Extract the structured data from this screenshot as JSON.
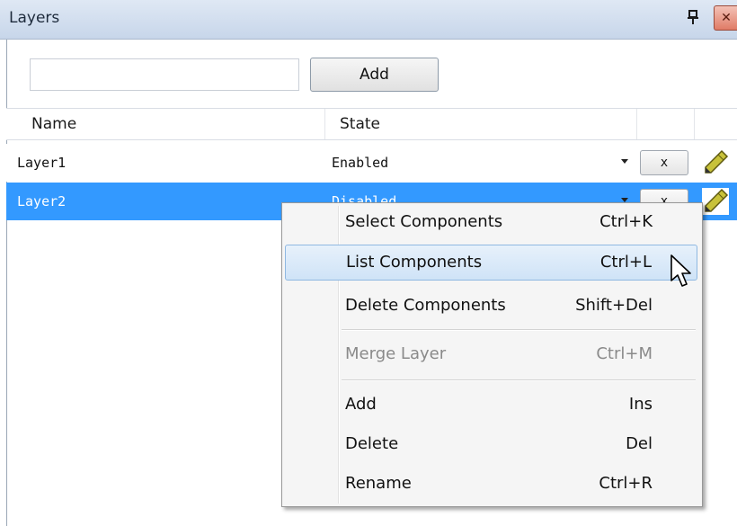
{
  "window": {
    "title": "Layers",
    "pin_icon": "pin-icon",
    "close_icon": "close-icon",
    "close_glyph": "✕"
  },
  "toolbar": {
    "search_value": "",
    "add_label": "Add"
  },
  "grid": {
    "columns": [
      "Name",
      "State",
      "",
      ""
    ],
    "rows": [
      {
        "name": "Layer1",
        "state": "Enabled",
        "delete_label": "x",
        "selected": false
      },
      {
        "name": "Layer2",
        "state": "Disabled",
        "delete_label": "x",
        "selected": true
      }
    ]
  },
  "context_menu": {
    "items": [
      {
        "label": "Select Components",
        "shortcut": "Ctrl+K",
        "enabled": true,
        "highlighted": false
      },
      {
        "label": "List Components",
        "shortcut": "Ctrl+L",
        "enabled": true,
        "highlighted": true
      },
      {
        "label": "Delete Components",
        "shortcut": "Shift+Del",
        "enabled": true,
        "highlighted": false
      },
      {
        "label": "Merge Layer",
        "shortcut": "Ctrl+M",
        "enabled": false,
        "highlighted": false
      },
      {
        "label": "Add",
        "shortcut": "Ins",
        "enabled": true,
        "highlighted": false
      },
      {
        "label": "Delete",
        "shortcut": "Del",
        "enabled": true,
        "highlighted": false
      },
      {
        "label": "Rename",
        "shortcut": "Ctrl+R",
        "enabled": true,
        "highlighted": false
      }
    ]
  },
  "colors": {
    "selection": "#3399ff",
    "menu_highlight": "#cfe3f7",
    "titlebar": "#c7d6ea"
  }
}
